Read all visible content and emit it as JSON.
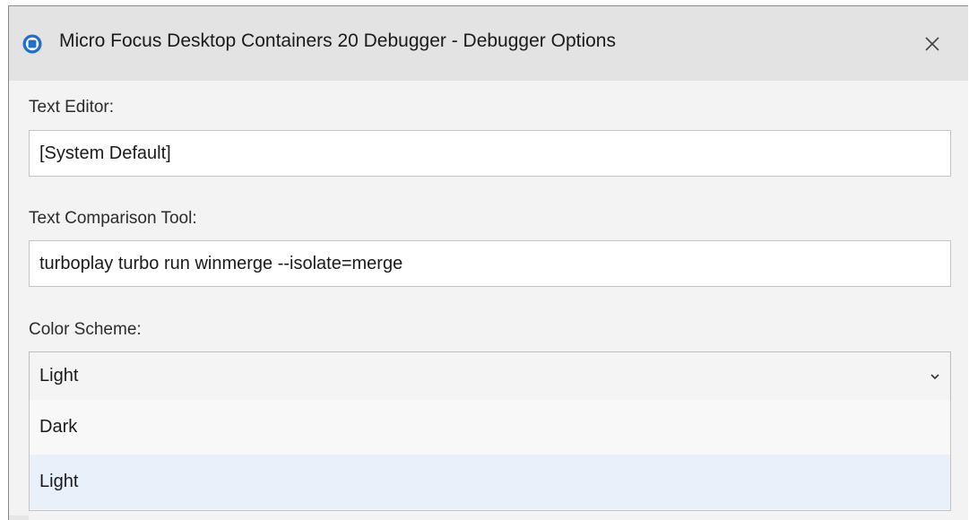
{
  "window": {
    "title": "Micro Focus Desktop Containers 20 Debugger - Debugger Options",
    "app_icon": "app-logo-icon",
    "close_icon": "close-icon",
    "accent_color": "#1f6fd0"
  },
  "text_editor": {
    "label": "Text Editor:",
    "value": "[System Default]"
  },
  "text_comparison_tool": {
    "label": "Text Comparison Tool:",
    "value": "turboplay turbo run winmerge --isolate=merge"
  },
  "color_scheme": {
    "label": "Color Scheme:",
    "selected": "Light",
    "chevron_icon": "chevron-down-icon",
    "options": [
      {
        "label": "Dark"
      },
      {
        "label": "Light",
        "highlighted": true
      }
    ]
  }
}
